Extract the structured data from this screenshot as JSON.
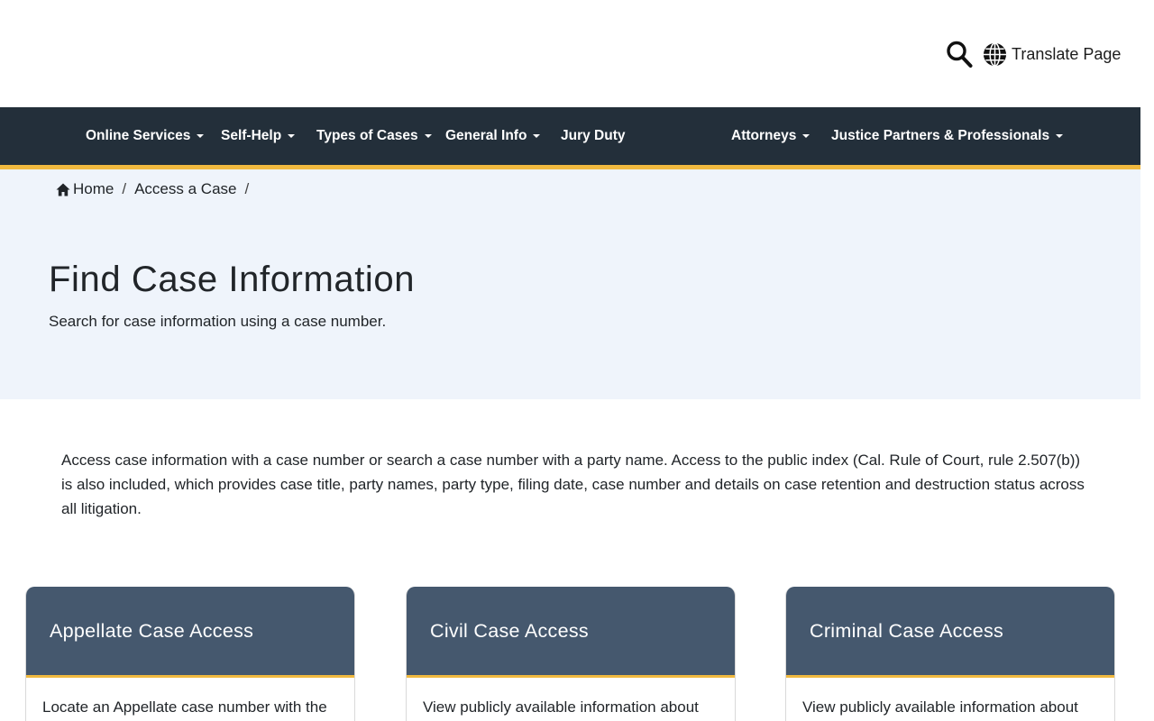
{
  "header": {
    "translate_label": "Translate Page"
  },
  "nav": {
    "items": [
      {
        "label": "Online Services",
        "dropdown": true
      },
      {
        "label": "Self-Help",
        "dropdown": true
      },
      {
        "label": "Types of Cases",
        "dropdown": true
      },
      {
        "label": "General Info",
        "dropdown": true
      },
      {
        "label": "Jury Duty",
        "dropdown": false
      },
      {
        "label": "Attorneys",
        "dropdown": true
      },
      {
        "label": "Justice Partners & Professionals",
        "dropdown": true
      }
    ]
  },
  "breadcrumb": {
    "home": "Home",
    "current": "Access a Case"
  },
  "hero": {
    "title": "Find Case Information",
    "subtitle": "Search for case information using a case number."
  },
  "intro": "Access case information with a case number or search a case number with a party name. Access to the public index (Cal. Rule of Court, rule 2.507(b)) is also included, which provides case title, party names, party type, filing date, case number and details on case retention and destruction status across all litigation.",
  "cards": [
    {
      "title": "Appellate Case Access",
      "body": "Locate an Appellate case number with the"
    },
    {
      "title": "Civil Case Access",
      "body": "View publicly available information about"
    },
    {
      "title": "Criminal Case Access",
      "body": "View publicly available information about"
    }
  ],
  "colors": {
    "navbar_bg": "#232f3a",
    "accent": "#f0b93f",
    "hero_bg": "#eff4fb",
    "card_header_bg": "#45586e"
  },
  "icons": [
    "search-icon",
    "globe-icon",
    "home-icon",
    "caret-down-icon"
  ]
}
